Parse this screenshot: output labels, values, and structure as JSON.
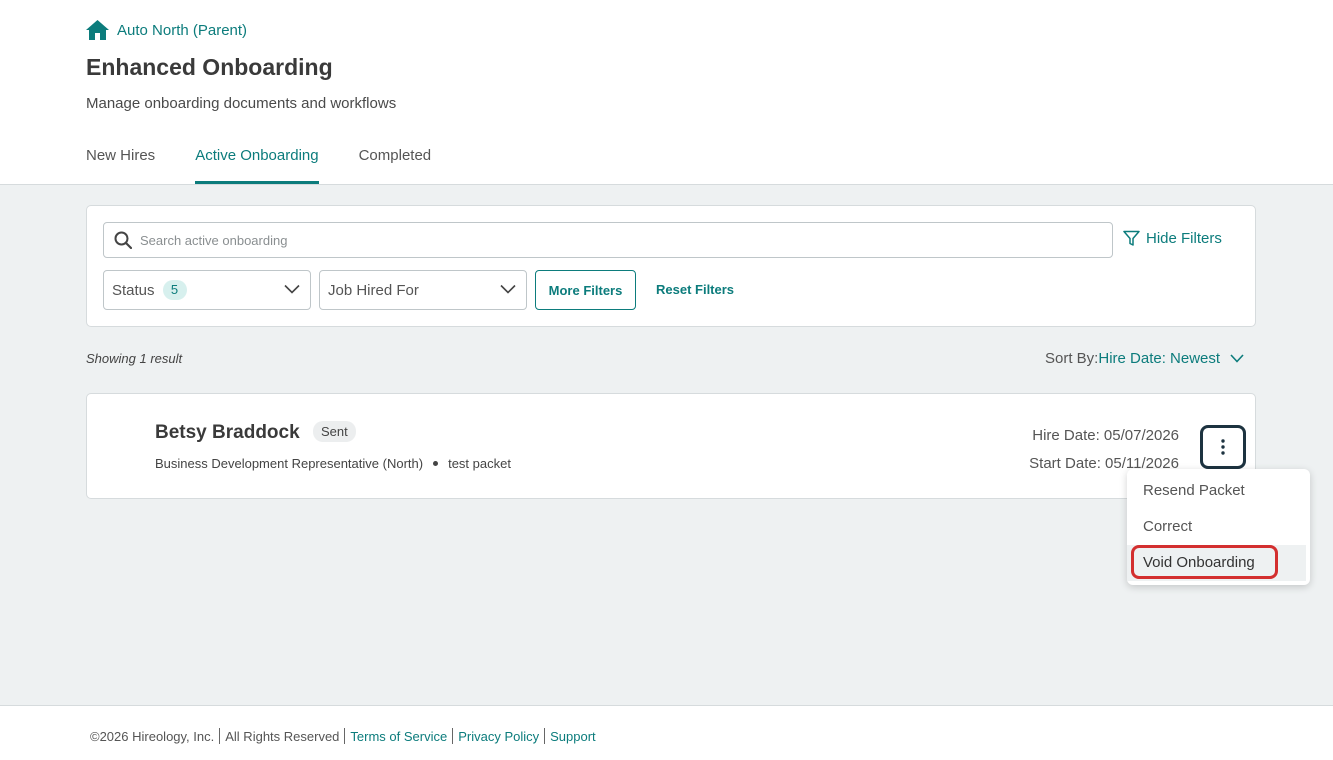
{
  "breadcrumb": {
    "label": "Auto North (Parent)",
    "icon": "home-icon"
  },
  "page": {
    "title": "Enhanced Onboarding",
    "subtitle": "Manage onboarding documents and workflows"
  },
  "tabs": [
    {
      "label": "New Hires",
      "active": false
    },
    {
      "label": "Active Onboarding",
      "active": true
    },
    {
      "label": "Completed",
      "active": false
    }
  ],
  "filters": {
    "search_placeholder": "Search active onboarding",
    "search_value": "",
    "hide_filters_label": "Hide Filters",
    "status_label": "Status",
    "status_count": "5",
    "job_label": "Job Hired For",
    "more_filters_label": "More Filters",
    "reset_filters_label": "Reset Filters"
  },
  "results": {
    "count_text": "Showing 1 result",
    "sort_label": "Sort By:",
    "sort_value": "Hire Date: Newest"
  },
  "candidate": {
    "name": "Betsy Braddock",
    "status": "Sent",
    "job": "Business Development Representative (North)",
    "packet": "test packet",
    "hire_date": "Hire Date: 05/07/2026",
    "start_date": "Start Date: 05/11/2026"
  },
  "action_menu": {
    "items": [
      "Resend Packet",
      "Correct",
      "Void Onboarding"
    ],
    "highlighted": "Void Onboarding"
  },
  "footer": {
    "copyright": "©2026 Hireology, Inc.",
    "rights": "All Rights Reserved",
    "terms": "Terms of Service",
    "privacy": "Privacy Policy",
    "support": "Support"
  },
  "colors": {
    "accent": "#0c7c7c",
    "highlight_ring": "#d32f2f",
    "background": "#eef1f2"
  }
}
